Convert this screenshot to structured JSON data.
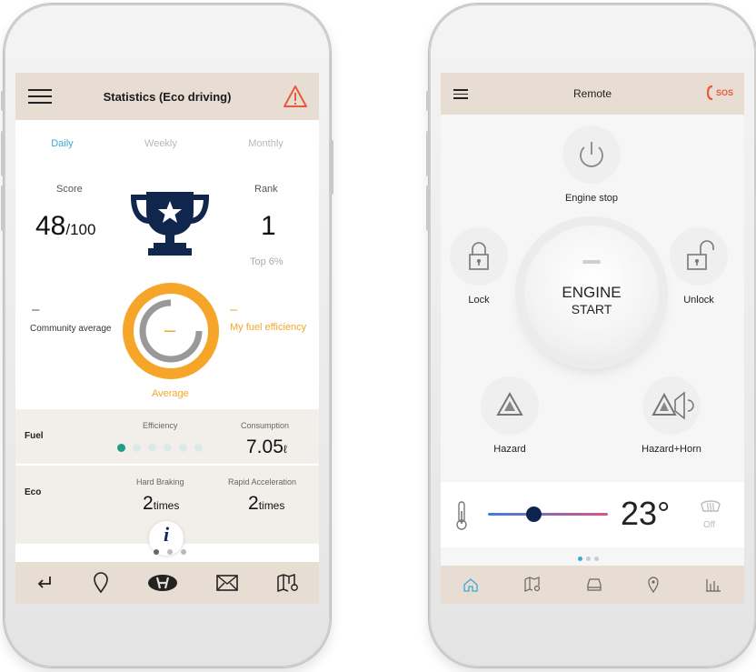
{
  "left": {
    "header": {
      "title": "Statistics (Eco driving)"
    },
    "tabs": [
      "Daily",
      "Weekly",
      "Monthly"
    ],
    "score": {
      "label": "Score",
      "value": "48",
      "suffix": "/100"
    },
    "rank": {
      "label": "Rank",
      "value": "1",
      "sub": "Top 6%"
    },
    "gauge": {
      "community_label": "Community average",
      "community_value": "–",
      "mine_label": "My fuel efficiency",
      "mine_value": "–",
      "center_value": "–",
      "caption": "Average"
    },
    "fuel": {
      "title": "Fuel",
      "efficiency_label": "Efficiency",
      "efficiency_level": 1,
      "efficiency_max": 6,
      "consumption_label": "Consumption",
      "consumption_value": "7.05",
      "consumption_unit": "ℓ"
    },
    "eco": {
      "title": "Eco",
      "hard_braking_label": "Hard Braking",
      "hard_braking_value": "2",
      "hard_braking_unit": "times",
      "rapid_acc_label": "Rapid Acceleration",
      "rapid_acc_value": "2",
      "rapid_acc_unit": "times"
    },
    "info_glyph": "i",
    "page_dots": {
      "count": 3,
      "active": 0
    },
    "nav_icons": [
      "back-icon",
      "location-pin-icon",
      "hyundai-logo-icon",
      "mail-icon",
      "map-icon"
    ]
  },
  "right": {
    "header": {
      "title": "Remote",
      "sos_label": "SOS"
    },
    "engine_stop": {
      "label": "Engine stop"
    },
    "engine_start": {
      "line1": "ENGINE",
      "line2": "START"
    },
    "lock": {
      "label": "Lock"
    },
    "unlock": {
      "label": "Unlock"
    },
    "hazard": {
      "label": "Hazard"
    },
    "hazard_horn": {
      "label": "Hazard+Horn"
    },
    "climate": {
      "temperature": "23°",
      "temp_fraction": 0.38,
      "defrost_label": "Off"
    },
    "page_dots": {
      "count": 3,
      "active": 0
    },
    "nav_icons": [
      "home-icon",
      "map-search-icon",
      "car-icon",
      "location-pin-icon",
      "stats-icon"
    ],
    "accent": "#3fa7d9",
    "alert_color": "#e85a3c"
  }
}
